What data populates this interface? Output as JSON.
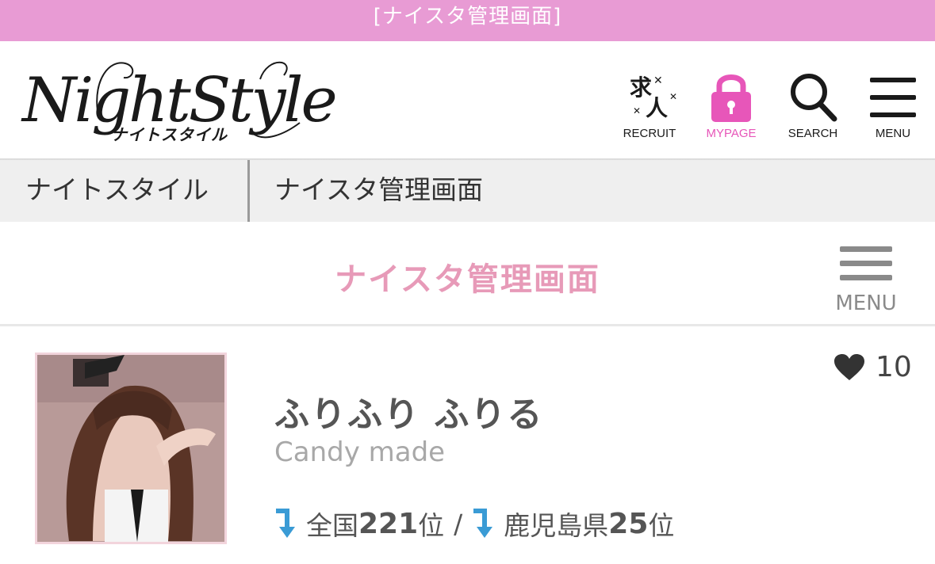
{
  "topbar": {
    "title": "[ナイスタ管理画面]"
  },
  "header": {
    "logo_text": "NightStyle",
    "logo_sub": "ナイトスタイル",
    "nav": {
      "recruit_glyph": "求人",
      "recruit_label": "RECRUIT",
      "mypage_label": "MYPAGE",
      "search_label": "SEARCH",
      "menu_label": "MENU"
    }
  },
  "breadcrumb": [
    "ナイトスタイル",
    "ナイスタ管理画面"
  ],
  "page": {
    "title": "ナイスタ管理画面",
    "menu_label": "MENU"
  },
  "cast": {
    "name": "ふりふり ふりる",
    "shop": "Candy made",
    "likes": "10",
    "rank": {
      "national_prefix": "全国",
      "national_value": "221",
      "national_suffix": "位",
      "separator": "/",
      "pref_prefix": "鹿児島県",
      "pref_value": "25",
      "pref_suffix": "位"
    }
  },
  "colors": {
    "topbar": "#e89bd4",
    "accent_pink": "#e756b9",
    "title_pink": "#e79ab8",
    "rank_arrow": "#3a9bd5"
  },
  "icons": [
    "recruit-icon",
    "lock-icon",
    "search-icon",
    "menu-icon",
    "heart-icon",
    "rank-down-arrow-icon"
  ]
}
